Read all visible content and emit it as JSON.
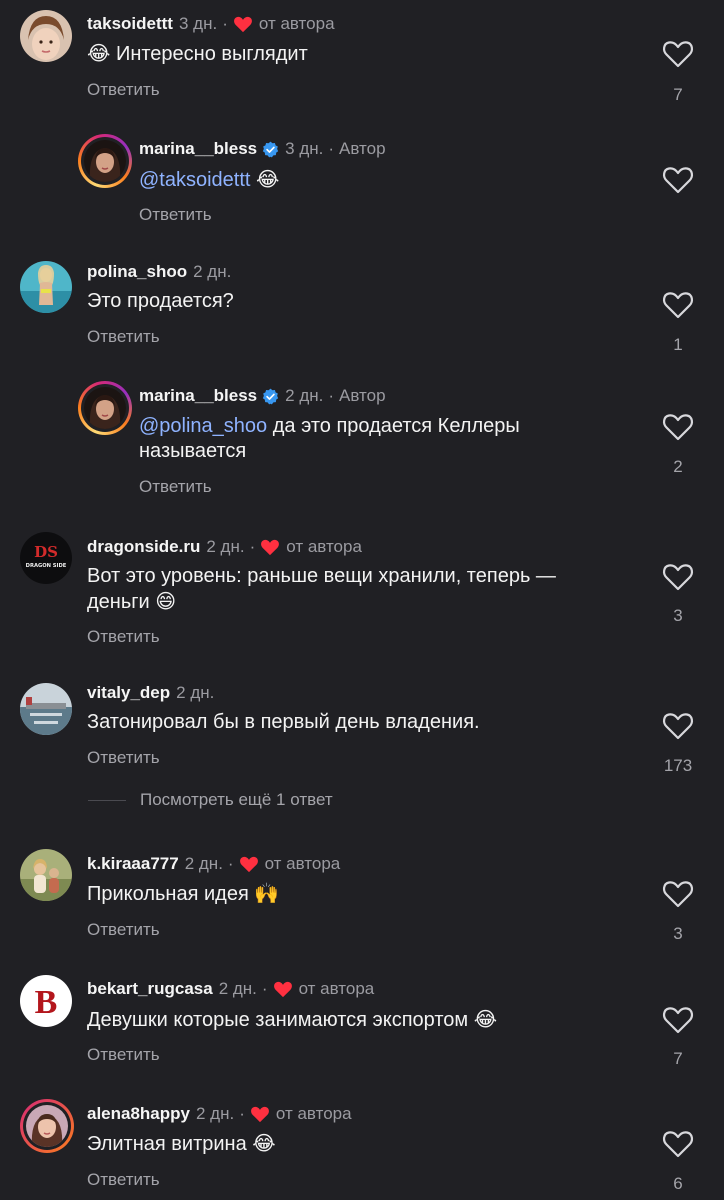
{
  "labels": {
    "reply": "Ответить",
    "by_author": "от автора",
    "author": "Автор",
    "dot": "·"
  },
  "colors": {
    "background": "#202024",
    "heart_red": "#ff3040",
    "mention": "#8fb3ff",
    "verified": "#3897f0"
  },
  "comments": [
    {
      "username": "taksoidettt",
      "time": "3 дн.",
      "liked_by_author": true,
      "emoji": "😂",
      "text": "Интересно выглядит",
      "likes": "7"
    },
    {
      "username": "marina__bless",
      "time": "3 дн.",
      "is_author": true,
      "mention": "@taksoidettt",
      "emoji": "😂",
      "likes": ""
    },
    {
      "username": "polina_shoo",
      "time": "2 дн.",
      "text": "Это продается?",
      "likes": "1"
    },
    {
      "username": "marina__bless",
      "time": "2 дн.",
      "is_author": true,
      "mention": "@polina_shoo",
      "text_line1": " да это продается Келлеры",
      "text_line2": "называется",
      "likes": "2"
    },
    {
      "username": "dragonside.ru",
      "time": "2 дн.",
      "liked_by_author": true,
      "text_line1": "Вот это уровень: раньше вещи хранили, теперь —",
      "text_line2": "деньги",
      "emoji": "😄",
      "likes": "3",
      "avatar_text": "DS",
      "avatar_subtext": "DRAGON SIDE"
    },
    {
      "username": "vitaly_dep",
      "time": "2 дн.",
      "text": "Затонировал бы в первый день владения.",
      "likes": "173"
    },
    {
      "username": "k.kiraaa777",
      "time": "2 дн.",
      "liked_by_author": true,
      "text": "Прикольная идея",
      "emoji": "🙌",
      "likes": "3"
    },
    {
      "username": "bekart_rugcasa",
      "time": "2 дн.",
      "liked_by_author": true,
      "text": "Девушки которые занимаются экспортом",
      "emoji": "😂",
      "likes": "7",
      "avatar_text": "B"
    },
    {
      "username": "alena8happy",
      "time": "2 дн.",
      "liked_by_author": true,
      "text": "Элитная витрина",
      "emoji": "😂",
      "likes": "6"
    }
  ],
  "view_more_replies": "Посмотреть ещё 1 ответ"
}
